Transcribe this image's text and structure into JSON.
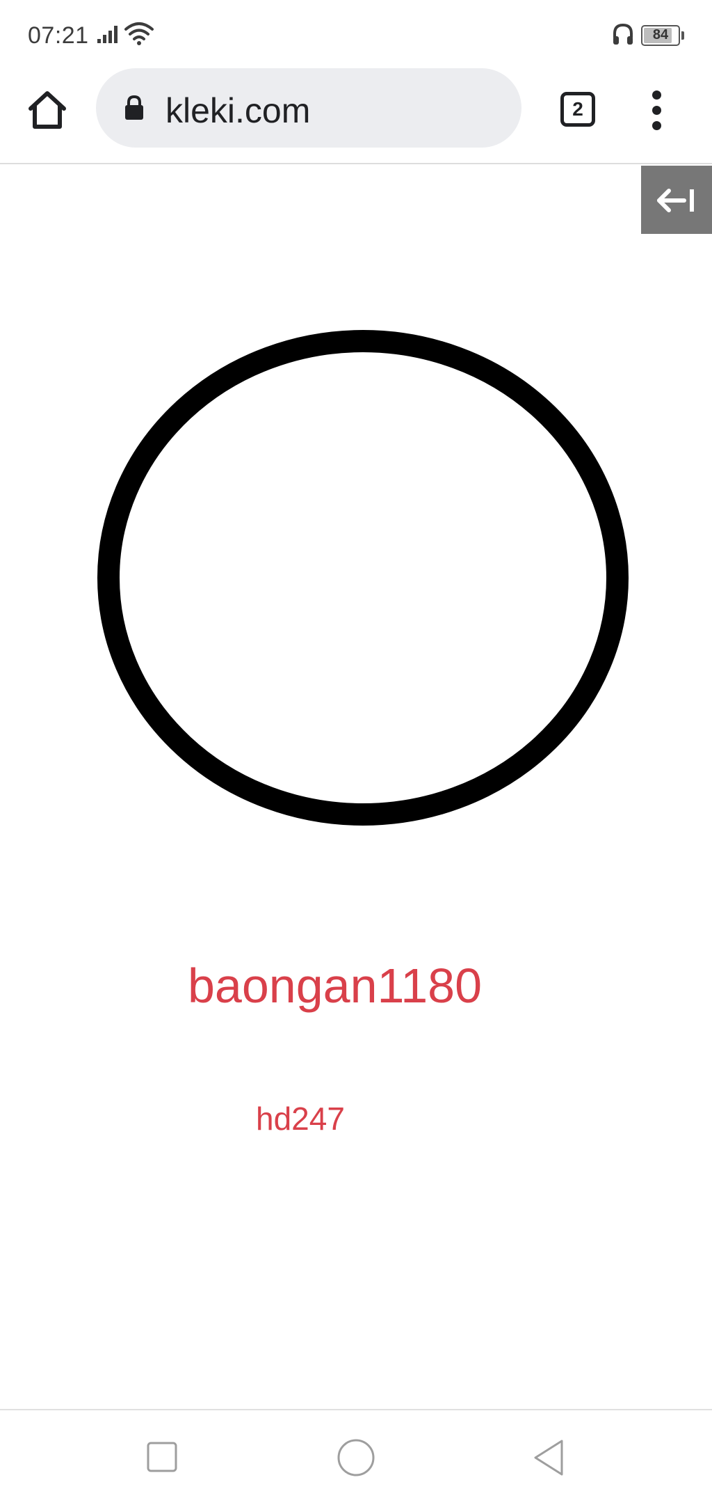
{
  "status_bar": {
    "time": "07:21",
    "battery_level": "84",
    "battery_percent": 84,
    "icons": [
      "signal-icon",
      "wifi-icon",
      "headphone-icon",
      "battery-icon"
    ]
  },
  "browser": {
    "url": "kleki.com",
    "tab_count": "2",
    "icons": [
      "home-icon",
      "lock-icon",
      "tabs-icon",
      "menu-icon"
    ]
  },
  "page": {
    "toolbar_collapse_icon": "collapse-arrow-icon",
    "canvas_text_1": "baongan1180",
    "canvas_text_2": "hd247",
    "text_color": "#d9404a",
    "collapse_button_color": "#777777"
  },
  "nav_bar": {
    "icons": [
      "recents-icon",
      "home-circle-icon",
      "back-triangle-icon"
    ]
  }
}
